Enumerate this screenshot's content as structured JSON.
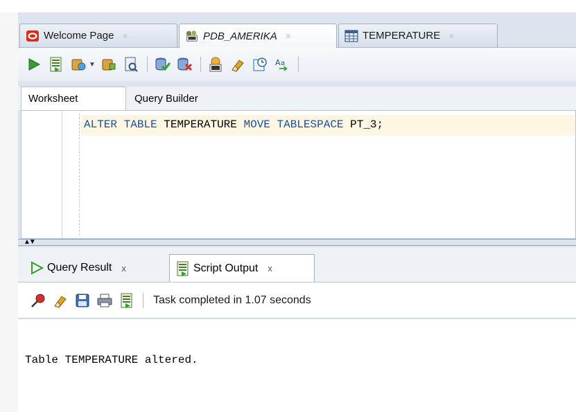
{
  "tabs": [
    {
      "label": "Welcome Page",
      "icon": "oracle-logo-icon"
    },
    {
      "label": "PDB_AMERIKA",
      "icon": "sql-connection-icon"
    },
    {
      "label": "TEMPERATURE",
      "icon": "table-grid-icon"
    }
  ],
  "tab_close_glyph": "×",
  "worksheet_tabs": [
    "Worksheet",
    "Query Builder"
  ],
  "editor": {
    "code_tokens": [
      "ALTER",
      "TABLE",
      "TEMPERATURE",
      "MOVE",
      "TABLESPACE",
      "PT_3;"
    ]
  },
  "results": {
    "tabs": [
      {
        "label": "Query Result",
        "icon": "run-arrow-icon"
      },
      {
        "label": "Script Output",
        "icon": "script-output-icon"
      }
    ],
    "close_glyph": "x",
    "status": "Task completed in 1.07 seconds",
    "output_text": "Table TEMPERATURE altered."
  },
  "colors": {
    "keyword": "#1d4f9c",
    "frame": "#dde4ee",
    "current_line": "#fdf6e3"
  }
}
